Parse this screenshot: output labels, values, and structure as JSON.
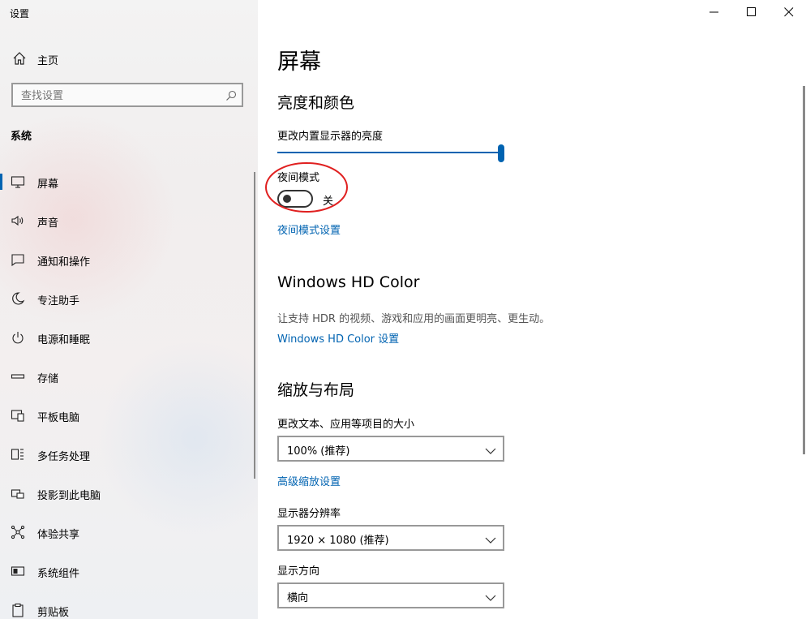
{
  "window": {
    "title": "设置",
    "controls": {
      "minimize": "minimize-icon",
      "maximize": "maximize-icon",
      "close": "close-icon"
    }
  },
  "sidebar": {
    "home_label": "主页",
    "search_placeholder": "查找设置",
    "section_label": "系统",
    "items": [
      {
        "label": "屏幕",
        "icon": "monitor-icon",
        "active": true
      },
      {
        "label": "声音",
        "icon": "speaker-icon"
      },
      {
        "label": "通知和操作",
        "icon": "notification-icon"
      },
      {
        "label": "专注助手",
        "icon": "moon-icon"
      },
      {
        "label": "电源和睡眠",
        "icon": "power-icon"
      },
      {
        "label": "存储",
        "icon": "storage-icon"
      },
      {
        "label": "平板电脑",
        "icon": "tablet-icon"
      },
      {
        "label": "多任务处理",
        "icon": "multitask-icon"
      },
      {
        "label": "投影到此电脑",
        "icon": "project-icon"
      },
      {
        "label": "体验共享",
        "icon": "share-icon"
      },
      {
        "label": "系统组件",
        "icon": "components-icon"
      },
      {
        "label": "剪贴板",
        "icon": "clipboard-icon"
      }
    ]
  },
  "main": {
    "title": "屏幕",
    "brightness_section": {
      "heading": "亮度和颜色",
      "slider_label": "更改内置显示器的亮度",
      "brightness_value": 100,
      "night_mode_label": "夜间模式",
      "night_mode_state": "关",
      "night_mode_on": false,
      "night_mode_link": "夜间模式设置"
    },
    "hdr_section": {
      "heading": "Windows HD Color",
      "description": "让支持 HDR 的视频、游戏和应用的画面更明亮、更生动。",
      "link": "Windows HD Color 设置"
    },
    "scale_section": {
      "heading": "缩放与布局",
      "scale_label": "更改文本、应用等项目的大小",
      "scale_value": "100% (推荐)",
      "advanced_link": "高级缩放设置",
      "resolution_label": "显示器分辨率",
      "resolution_value": "1920 × 1080 (推荐)",
      "orientation_label": "显示方向",
      "orientation_value": "横向"
    }
  },
  "colors": {
    "accent": "#0063b1",
    "annotation": "#e02020"
  }
}
